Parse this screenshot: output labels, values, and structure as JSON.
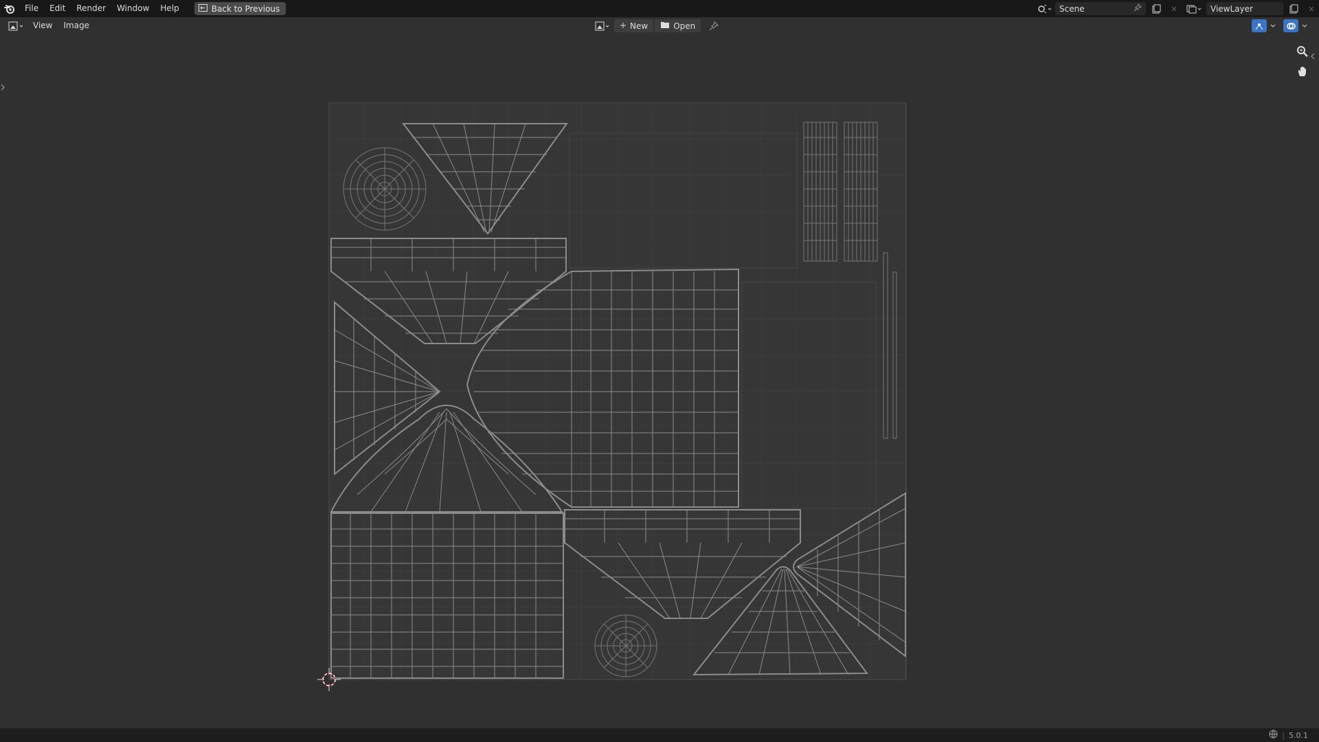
{
  "topbar": {
    "menus": [
      "File",
      "Edit",
      "Render",
      "Window",
      "Help"
    ],
    "back_button": "Back to Previous",
    "scene_name": "Scene",
    "view_layer": "ViewLayer"
  },
  "header": {
    "menus": [
      "View",
      "Image"
    ],
    "new_button": "New",
    "open_button": "Open"
  },
  "status": {
    "version": "5.0.1"
  },
  "colors": {
    "wire": "#8c8c8c",
    "wire_dim": "#6a6a6a",
    "background": "#303030",
    "uv_tile": "#3a3a3a",
    "accent": "#3a74c6"
  }
}
